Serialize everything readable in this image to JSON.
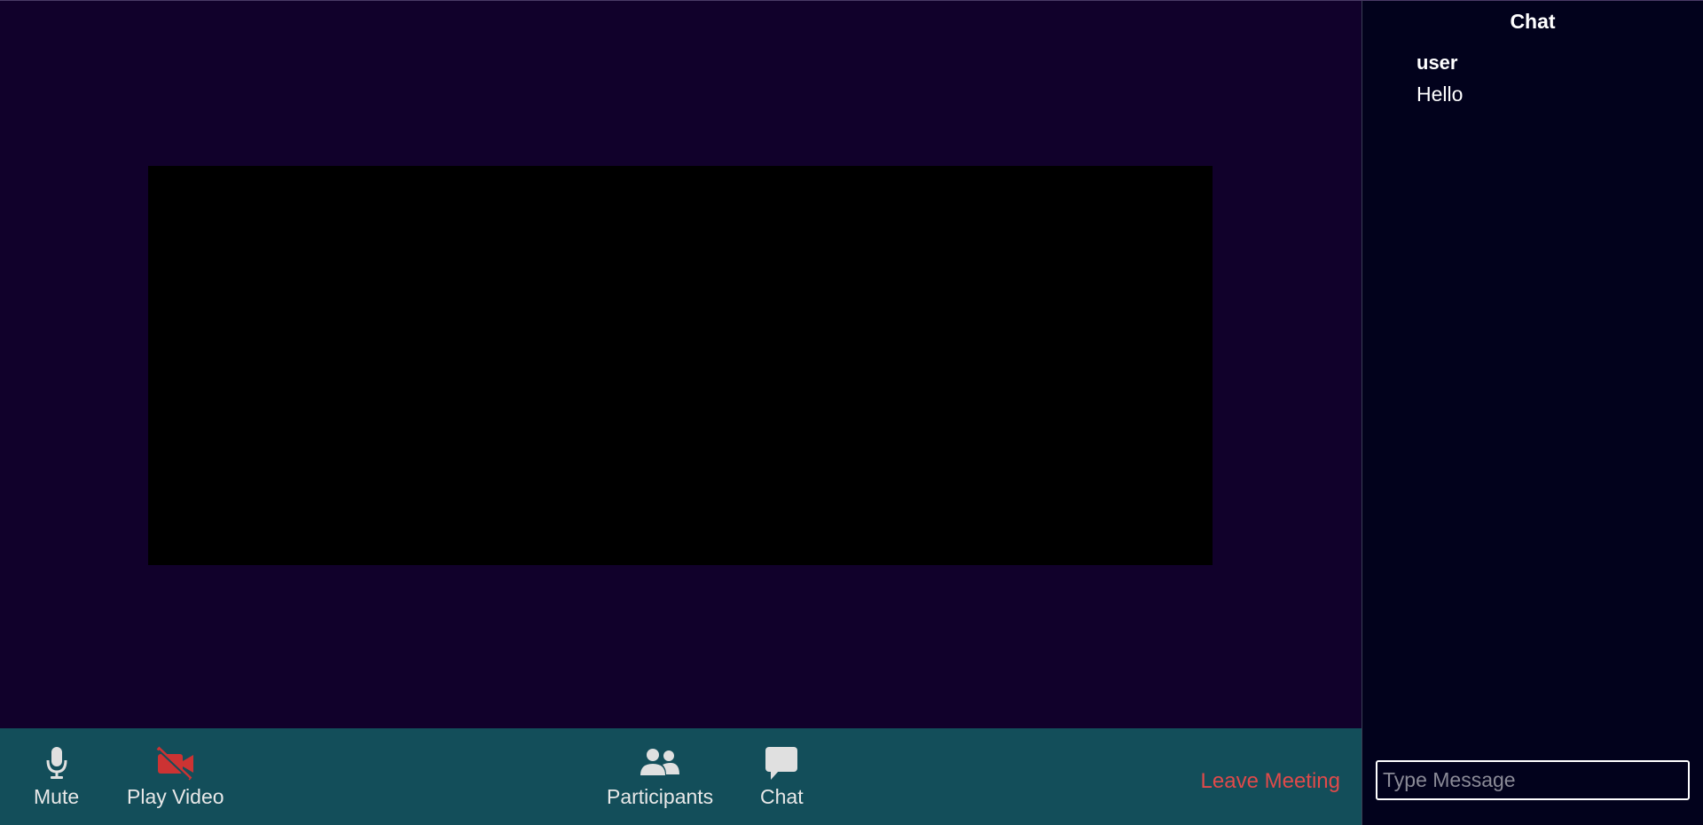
{
  "controls": {
    "mute_label": "Mute",
    "video_label": "Play Video",
    "participants_label": "Participants",
    "chat_label": "Chat",
    "leave_label": "Leave Meeting"
  },
  "chat": {
    "title": "Chat",
    "messages": [
      {
        "user": "user",
        "text": "Hello"
      }
    ],
    "input_placeholder": "Type Message"
  },
  "colors": {
    "background": "#11012b",
    "controls_bar": "#134e5a",
    "sidebar": "#02021c",
    "video_tile": "#000000",
    "leave_accent": "#e04a4a",
    "video_off_icon": "#cc3333",
    "icon_gray": "#e0e0e0"
  },
  "icons": {
    "mute": "microphone-icon",
    "video": "video-off-icon",
    "participants": "participants-icon",
    "chat": "chat-bubble-icon"
  }
}
